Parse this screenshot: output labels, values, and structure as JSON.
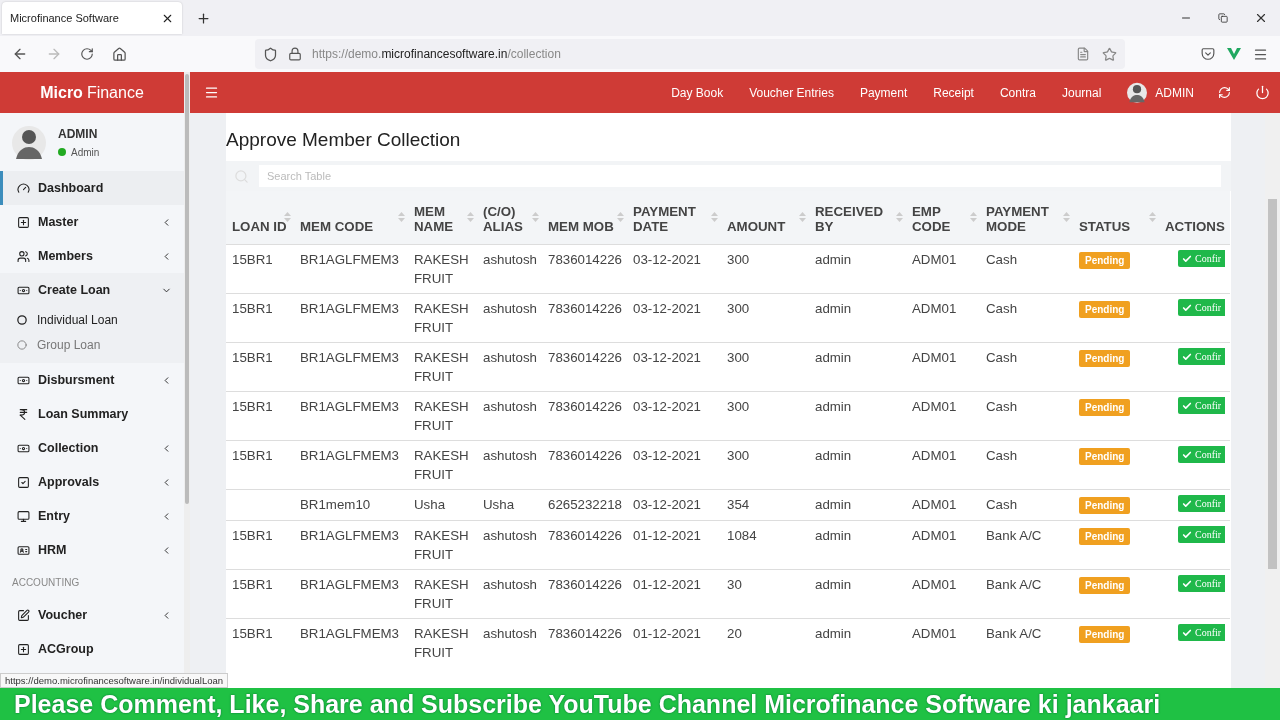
{
  "browser": {
    "tab_title": "Microfinance Software",
    "url_prefix": "https://demo.",
    "url_domain": "microfinancesoftware.in",
    "url_path": "/collection",
    "status_url": "https://demo.microfinancesoftware.in/individualLoan"
  },
  "header": {
    "brand_bold": "Micro",
    "brand_light": "Finance",
    "nav": [
      "Day Book",
      "Voucher Entries",
      "Payment",
      "Receipt",
      "Contra",
      "Journal"
    ],
    "user": "ADMIN"
  },
  "sidebar": {
    "user_name": "ADMIN",
    "user_role": "Admin",
    "online": true,
    "items": [
      {
        "kind": "item",
        "label": "Dashboard",
        "selected": true
      },
      {
        "kind": "item",
        "label": "Master",
        "selected": false,
        "expanded": false
      },
      {
        "kind": "item",
        "label": "Members",
        "selected": false,
        "expanded": false
      },
      {
        "kind": "item",
        "label": "Create Loan",
        "selected": false,
        "expanded": true,
        "children": [
          {
            "label": "Individual Loan",
            "selected": true
          },
          {
            "label": "Group Loan",
            "selected": false
          }
        ]
      },
      {
        "kind": "item",
        "label": "Disbursment",
        "selected": false,
        "expanded": false
      },
      {
        "kind": "item",
        "label": "Loan Summary",
        "selected": false
      },
      {
        "kind": "item",
        "label": "Collection",
        "selected": false,
        "expanded": false
      },
      {
        "kind": "item",
        "label": "Approvals",
        "selected": false,
        "expanded": false
      },
      {
        "kind": "item",
        "label": "Entry",
        "selected": false,
        "expanded": false
      },
      {
        "kind": "item",
        "label": "HRM",
        "selected": false,
        "expanded": false
      },
      {
        "kind": "heading",
        "label": "ACCOUNTING"
      },
      {
        "kind": "item",
        "label": "Voucher",
        "selected": false,
        "expanded": false
      },
      {
        "kind": "item",
        "label": "ACGroup",
        "selected": false
      }
    ]
  },
  "page": {
    "title": "Approve Member Collection",
    "search": {
      "placeholder": "Search Table"
    }
  },
  "table": {
    "columns": [
      "LOAN ID",
      "MEM CODE",
      "MEM NAME",
      "(C/O) ALIAS",
      "MEM MOB",
      "PAYMENT DATE",
      "AMOUNT",
      "RECEIVED BY",
      "EMP CODE",
      "PAYMENT MODE",
      "STATUS",
      "ACTIONS"
    ],
    "rows": [
      {
        "cells": [
          "15BR1",
          "BR1AGLFMEM3",
          "RAKESH FRUIT",
          "ashutosh",
          "7836014226",
          "03-12-2021",
          "300",
          "admin",
          "ADM01",
          "Cash"
        ],
        "status": "Pending",
        "action": "Confir"
      },
      {
        "cells": [
          "15BR1",
          "BR1AGLFMEM3",
          "RAKESH FRUIT",
          "ashutosh",
          "7836014226",
          "03-12-2021",
          "300",
          "admin",
          "ADM01",
          "Cash"
        ],
        "status": "Pending",
        "action": "Confir"
      },
      {
        "cells": [
          "15BR1",
          "BR1AGLFMEM3",
          "RAKESH FRUIT",
          "ashutosh",
          "7836014226",
          "03-12-2021",
          "300",
          "admin",
          "ADM01",
          "Cash"
        ],
        "status": "Pending",
        "action": "Confir"
      },
      {
        "cells": [
          "15BR1",
          "BR1AGLFMEM3",
          "RAKESH FRUIT",
          "ashutosh",
          "7836014226",
          "03-12-2021",
          "300",
          "admin",
          "ADM01",
          "Cash"
        ],
        "status": "Pending",
        "action": "Confir"
      },
      {
        "cells": [
          "15BR1",
          "BR1AGLFMEM3",
          "RAKESH FRUIT",
          "ashutosh",
          "7836014226",
          "03-12-2021",
          "300",
          "admin",
          "ADM01",
          "Cash"
        ],
        "status": "Pending",
        "action": "Confir"
      },
      {
        "cells": [
          "",
          "BR1mem10",
          "Usha",
          "Usha",
          "6265232218",
          "03-12-2021",
          "354",
          "admin",
          "ADM01",
          "Cash"
        ],
        "status": "Pending",
        "action": "Confir"
      },
      {
        "cells": [
          "15BR1",
          "BR1AGLFMEM3",
          "RAKESH FRUIT",
          "ashutosh",
          "7836014226",
          "01-12-2021",
          "1084",
          "admin",
          "ADM01",
          "Bank A/C"
        ],
        "status": "Pending",
        "action": "Confir"
      },
      {
        "cells": [
          "15BR1",
          "BR1AGLFMEM3",
          "RAKESH FRUIT",
          "ashutosh",
          "7836014226",
          "01-12-2021",
          "30",
          "admin",
          "ADM01",
          "Bank A/C"
        ],
        "status": "Pending",
        "action": "Confir"
      },
      {
        "cells": [
          "15BR1",
          "BR1AGLFMEM3",
          "RAKESH FRUIT",
          "ashutosh",
          "7836014226",
          "01-12-2021",
          "20",
          "admin",
          "ADM01",
          "Bank A/C"
        ],
        "status": "Pending",
        "action": "Confir"
      }
    ]
  },
  "overlay_banner": "Please Comment, Like, Share and Subscribe YouTube Channel Microfinance Software ki jankaari"
}
